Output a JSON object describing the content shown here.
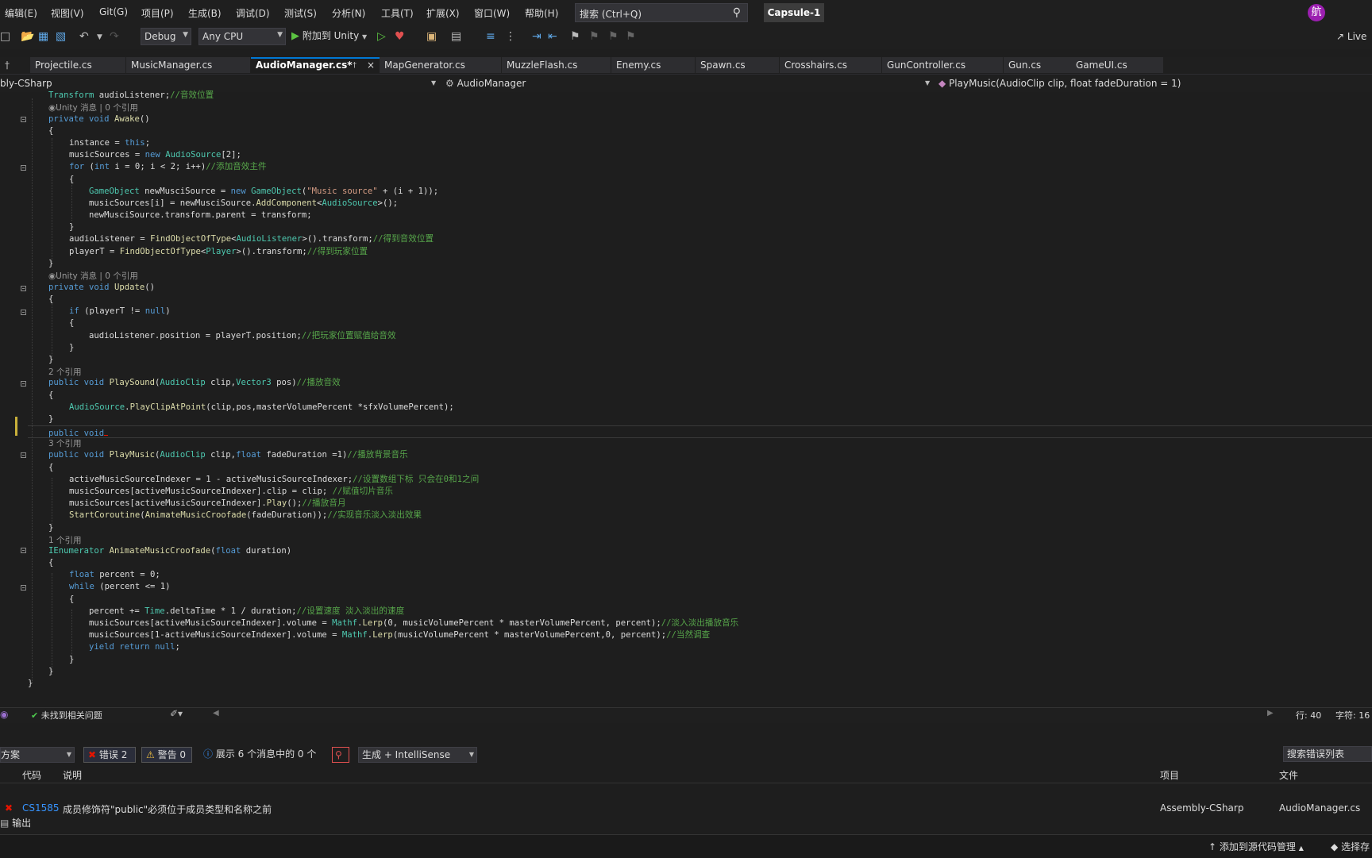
{
  "menu": {
    "items": [
      "编辑(E)",
      "视图(V)",
      "Git(G)",
      "项目(P)",
      "生成(B)",
      "调试(D)",
      "测试(S)",
      "分析(N)",
      "工具(T)",
      "扩展(X)",
      "窗口(W)",
      "帮助(H)"
    ],
    "search_placeholder": "搜索 (Ctrl+Q)",
    "solution_name": "Capsule-1",
    "avatar_letter": "航"
  },
  "toolbar": {
    "config": "Debug",
    "platform": "Any CPU",
    "attach_label": "附加到 Unity",
    "liveshare_label": "Live"
  },
  "tabs": [
    {
      "label": "Projectile.cs"
    },
    {
      "label": "MusicManager.cs"
    },
    {
      "label": "AudioManager.cs*"
    },
    {
      "label": "MapGenerator.cs"
    },
    {
      "label": "MuzzleFlash.cs"
    },
    {
      "label": "Enemy.cs"
    },
    {
      "label": "Spawn.cs"
    },
    {
      "label": "Crosshairs.cs"
    },
    {
      "label": "GunController.cs"
    },
    {
      "label": "Gun.cs"
    },
    {
      "label": "GameUI.cs"
    }
  ],
  "navbar": {
    "project": "bly-CSharp",
    "class": "AudioManager",
    "member": "PlayMusic(AudioClip clip, float fadeDuration = 1)"
  },
  "code": {
    "lens_unity_1": "Unity 消息 | 0 个引用",
    "lens_unity_2": "Unity 消息 | 0 个引用",
    "lens_refs_2": "2 个引用",
    "lens_refs_3": "3 个引用",
    "lens_refs_1": "1 个引用",
    "comments": {
      "audio_pos": "//音效位置",
      "add_source": "//添加音效主件",
      "get_audio_pos": "//得到音效位置",
      "get_player_pos": "//得到玩家位置",
      "assign_pos": "//把玩家位置赋值给音效",
      "play_sound": "//播放音效",
      "play_bg": "//播放背景音乐",
      "set_index": "//设置数组下标 只会在0和1之间",
      "assign_clip": "//赋值切片音乐",
      "play_track": "//播放音月",
      "fade_effect": "//实现音乐淡入淡出效果",
      "set_speed": "//设置速度 淡入淡出的速度",
      "fade_play": "//淡入淡出播放音乐",
      "undo_adjust": "//当然调查"
    },
    "string_music_source": "\"Music source\""
  },
  "status": {
    "issues": "未找到相关问题",
    "line": "行: 40",
    "col": "字符: 16"
  },
  "errorlist": {
    "scope": "方案",
    "errors_label": "错误 2",
    "warnings_label": "警告 0",
    "messages_label": "展示 6 个消息中的 0 个",
    "build_filter": "生成 + IntelliSense",
    "search_placeholder": "搜索错误列表",
    "col_code": "代码",
    "col_desc": "说明",
    "col_project": "项目",
    "col_file": "文件",
    "rows": [
      {
        "code": "CS1585",
        "desc": "成员修饰符\"public\"必须位于成员类型和名称之前",
        "project": "Assembly-CSharp",
        "file": "AudioManager.cs"
      }
    ],
    "output_tab": "输出"
  },
  "bottombar": {
    "source_control": "添加到源代码管理",
    "repo": "选择存"
  },
  "colors": {
    "keyword": "#569cd6",
    "type": "#4ec9b0",
    "comment": "#57a64a",
    "string": "#d69d85",
    "method": "#dcdcaa",
    "accent": "#0078d4",
    "error": "#e51400"
  }
}
